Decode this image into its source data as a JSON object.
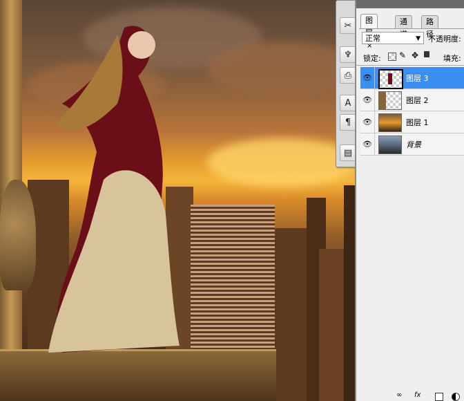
{
  "panel": {
    "tabs": [
      {
        "label": "图层",
        "close": "×"
      },
      {
        "label": "通道"
      },
      {
        "label": "路径"
      }
    ],
    "blend_mode": "正常",
    "opacity_label": "不透明度:",
    "lock_label": "锁定:",
    "fill_label": "填充:",
    "layers": [
      {
        "name": "图层 3",
        "selected": true
      },
      {
        "name": "图层 2",
        "selected": false
      },
      {
        "name": "图层 1",
        "selected": false
      },
      {
        "name": "背景",
        "selected": false
      }
    ],
    "footer_fx": "fx"
  },
  "tools": [
    {
      "icon": "wrench-icon",
      "glyph": "✂"
    },
    {
      "icon": "brush-icon",
      "glyph": "♆"
    },
    {
      "icon": "stamp-icon",
      "glyph": "⎙"
    },
    {
      "icon": "text-icon",
      "glyph": "A"
    },
    {
      "icon": "paragraph-icon",
      "glyph": "¶"
    },
    {
      "icon": "notes-icon",
      "glyph": "▤"
    }
  ]
}
